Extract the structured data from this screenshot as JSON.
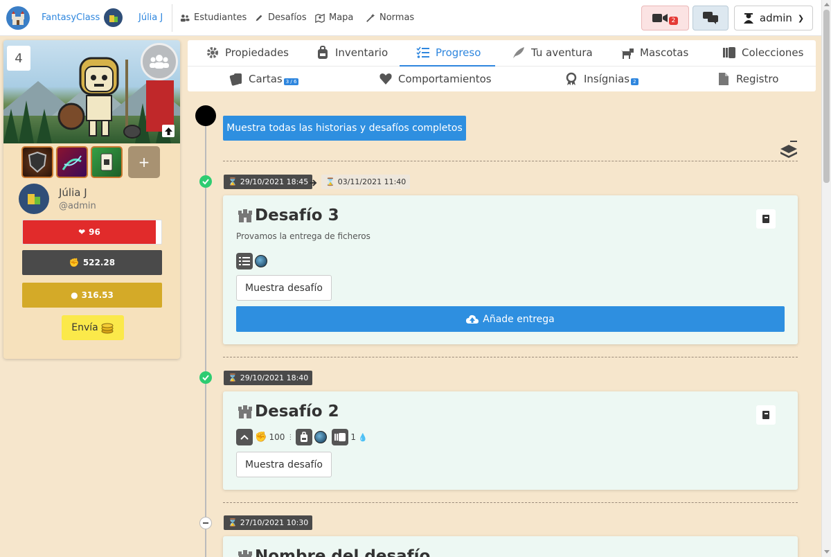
{
  "nav": {
    "brand": "FantasyClass",
    "user": "Júlia J",
    "links": {
      "students": "Estudiantes",
      "challenges": "Desafíos",
      "map": "Mapa",
      "rules": "Normas"
    },
    "video_badge": "2",
    "admin_label": "admin"
  },
  "player": {
    "level": "4",
    "name": "Júlia J",
    "handle": "@admin",
    "hp": "96",
    "hp_fraction": 0.96,
    "xp": "522.28",
    "gold": "316.53",
    "send_label": "Envía",
    "add_card": "+"
  },
  "tabs": {
    "row1": [
      "Propiedades",
      "Inventario",
      "Progreso",
      "Tu aventura",
      "Mascotas",
      "Colecciones"
    ],
    "row2": [
      "Cartas",
      "Comportamientos",
      "Insígnias",
      "Registro"
    ],
    "cards_badge": "3 / 6",
    "badges_badge": "2"
  },
  "timeline": {
    "show_all": "Muestra todas las historias y desafíos completos",
    "items": [
      {
        "start": "29/10/2021 18:45",
        "end": "03/11/2021 11:40",
        "title": "Desafío 3",
        "description": "Provamos la entrega de ficheros",
        "show_button": "Muestra desafío",
        "deliver_button": "Añade entrega"
      },
      {
        "start": "29/10/2021 18:40",
        "title": "Desafío 2",
        "xp_reward": "100",
        "collection_count": "1",
        "show_button": "Muestra desafío"
      },
      {
        "start": "27/10/2021 10:30",
        "title": "Nombre del desafío"
      }
    ]
  },
  "colors": {
    "accent": "#2e8fe0",
    "hp": "#e12b2b",
    "xp": "#4a4a4a",
    "gold": "#d4aa28",
    "background": "#f6e6cc",
    "success": "#2ecc71"
  }
}
